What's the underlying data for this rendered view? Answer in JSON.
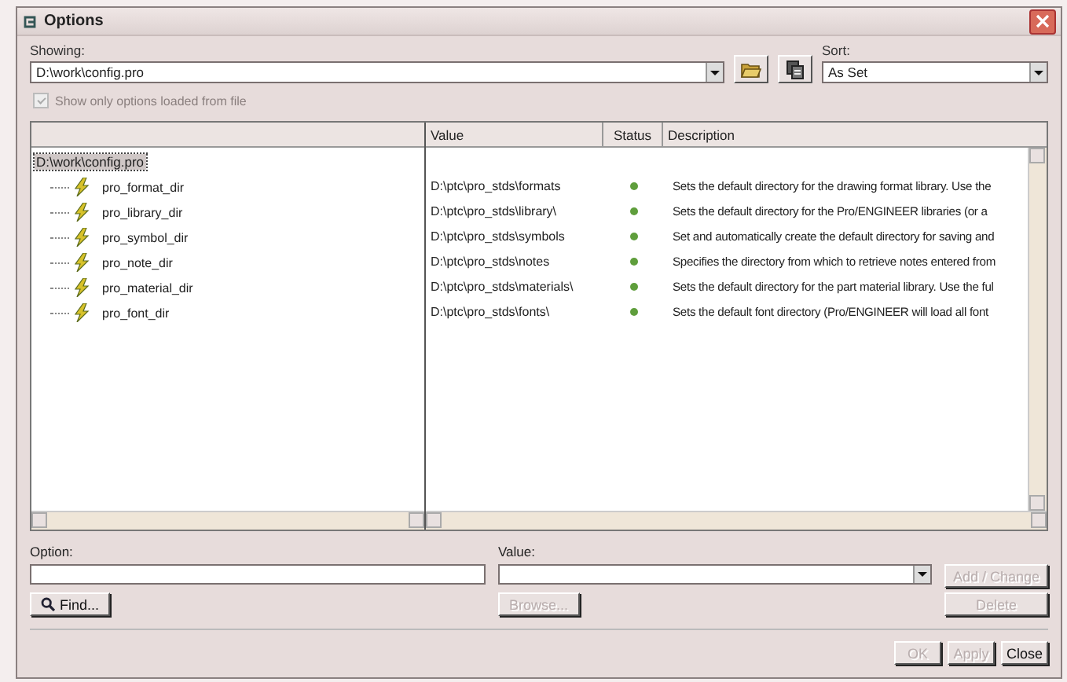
{
  "window": {
    "title": "Options"
  },
  "showing": {
    "label": "Showing:",
    "value": "D:\\work\\config.pro"
  },
  "sort": {
    "label": "Sort:",
    "value": "As Set"
  },
  "show_only_loaded": {
    "label": "Show only options loaded from file",
    "checked": true,
    "disabled": true
  },
  "tree": {
    "root": {
      "label": "D:\\work\\config.pro",
      "selected": true,
      "children": [
        {
          "label": "pro_format_dir"
        },
        {
          "label": "pro_library_dir"
        },
        {
          "label": "pro_symbol_dir"
        },
        {
          "label": "pro_note_dir"
        },
        {
          "label": "pro_material_dir"
        },
        {
          "label": "pro_font_dir"
        }
      ]
    }
  },
  "table": {
    "columns": [
      "Value",
      "Status",
      "Description"
    ],
    "rows": [
      {
        "value": "D:\\ptc\\pro_stds\\formats",
        "color": "#5f9e3c",
        "description": "Sets the default directory for the drawing format library. Use the"
      },
      {
        "value": "D:\\ptc\\pro_stds\\library\\",
        "color": "#5f9e3c",
        "description": "Sets the default directory for the Pro/ENGINEER libraries (or a"
      },
      {
        "value": "D:\\ptc\\pro_stds\\symbols",
        "color": "#5f9e3c",
        "description": "Set and automatically create the default directory for saving and"
      },
      {
        "value": "D:\\ptc\\pro_stds\\notes",
        "color": "#5f9e3c",
        "description": "Specifies the directory from which to retrieve notes entered from"
      },
      {
        "value": "D:\\ptc\\pro_stds\\materials\\",
        "color": "#5f9e3c",
        "description": "Sets the default directory for the part material library. Use the ful"
      },
      {
        "value": "D:\\ptc\\pro_stds\\fonts\\",
        "color": "#5f9e3c",
        "description": "Sets the default font directory (Pro/ENGINEER will load all font"
      }
    ]
  },
  "option_field": {
    "label": "Option:"
  },
  "value_field": {
    "label": "Value:"
  },
  "buttons": [
    {
      "label": "Find...",
      "kind": "find",
      "disabled": false
    },
    {
      "label": "Browse...",
      "kind": "browse",
      "disabled": true
    },
    {
      "label": "Add / Change",
      "kind": "add",
      "disabled": true
    },
    {
      "label": "Delete",
      "kind": "delete",
      "disabled": true
    }
  ],
  "footer_buttons": [
    {
      "label": "OK",
      "disabled": true
    },
    {
      "label": "Apply",
      "disabled": true
    },
    {
      "label": "Close",
      "disabled": false
    }
  ]
}
